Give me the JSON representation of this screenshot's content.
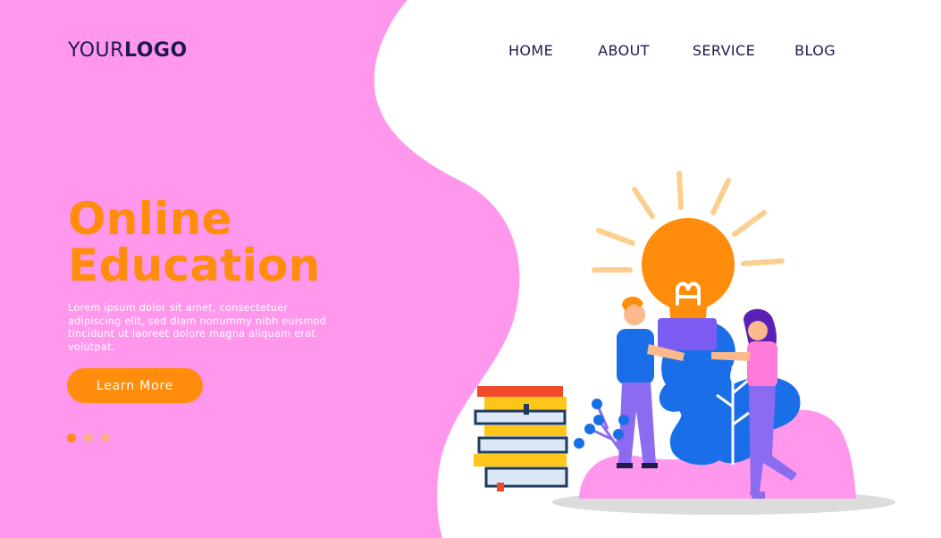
{
  "header": {
    "logo_regular": "YOUR",
    "logo_bold": "LOGO",
    "nav": [
      {
        "label": "HOME"
      },
      {
        "label": "ABOUT"
      },
      {
        "label": "SERVICE"
      },
      {
        "label": "BLOG"
      }
    ]
  },
  "hero": {
    "title_line1": "Online",
    "title_line2": "Education",
    "text": "Lorem ipsum dolor sit amet, consectetuer adipiscing elit, sed diam nonummy nibh euismod tincidunt ut laoreet dolore magna aliquam erat volutpat.",
    "cta_label": "Learn More"
  },
  "slider": {
    "total": 3,
    "active": 1
  },
  "colors": {
    "pink": "#ff98ec",
    "orange": "#ff8c0a",
    "navy": "#1e1b4b",
    "blue": "#1a6fe8",
    "purple": "#8b6cf0"
  },
  "illustration": {
    "icons": [
      "lightbulb-icon",
      "book-stack-icon",
      "man-figure",
      "woman-figure",
      "plant-icon"
    ]
  }
}
